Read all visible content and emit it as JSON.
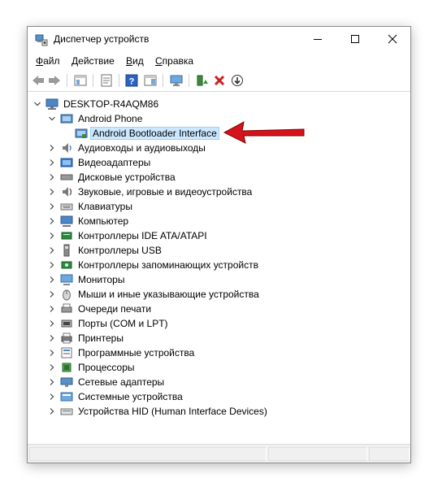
{
  "window": {
    "title": "Диспетчер устройств"
  },
  "menu": {
    "items": [
      {
        "u": "Ф",
        "rest": "айл"
      },
      {
        "u": "Д",
        "rest": "ействие"
      },
      {
        "u": "В",
        "rest": "ид"
      },
      {
        "u": "С",
        "rest": "правка"
      }
    ]
  },
  "toolbar": {
    "icons": [
      "back-arrow-icon",
      "forward-arrow-icon",
      "show-hide-tree-icon",
      "properties-icon",
      "help-icon",
      "action-pane-icon",
      "monitor-icon",
      "update-driver-icon",
      "uninstall-device-icon",
      "scan-hardware-icon"
    ]
  },
  "tree": {
    "computer": "DESKTOP-R4AQM86",
    "android_category": "Android Phone",
    "android_device": "Android Bootloader Interface",
    "categories": [
      "Аудиовходы и аудиовыходы",
      "Видеоадаптеры",
      "Дисковые устройства",
      "Звуковые, игровые и видеоустройства",
      "Клавиатуры",
      "Компьютер",
      "Контроллеры IDE ATA/ATAPI",
      "Контроллеры USB",
      "Контроллеры запоминающих устройств",
      "Мониторы",
      "Мыши и иные указывающие устройства",
      "Очереди печати",
      "Порты (COM и LPT)",
      "Принтеры",
      "Программные устройства",
      "Процессоры",
      "Сетевые адаптеры",
      "Системные устройства",
      "Устройства HID (Human Interface Devices)"
    ]
  },
  "annotation": {
    "arrow_color": "#d6131b"
  }
}
